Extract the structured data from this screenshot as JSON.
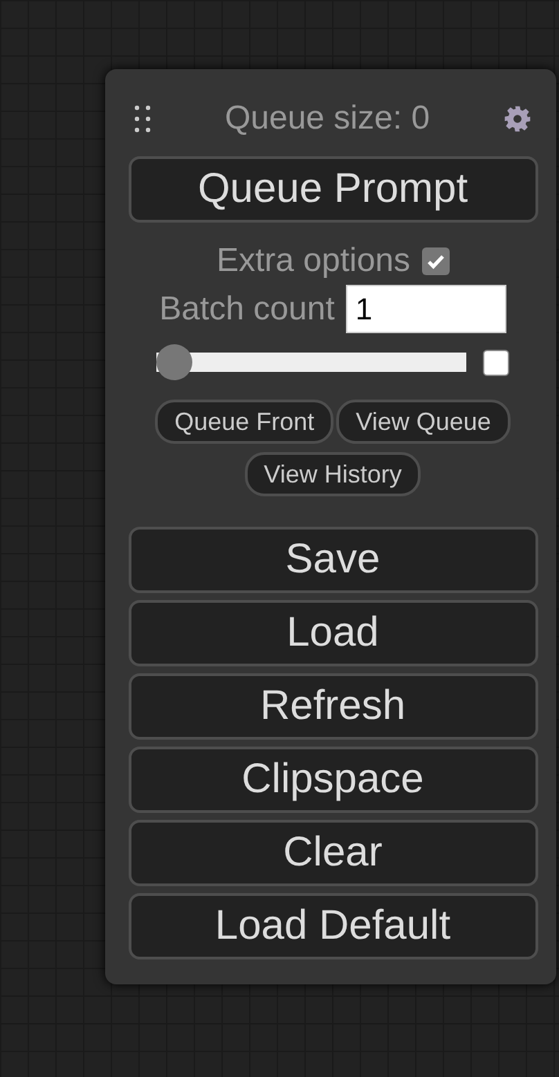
{
  "header": {
    "queue_size": "Queue size: 0"
  },
  "queue_button": "Queue Prompt",
  "extra_options": {
    "label": "Extra options",
    "checked": true
  },
  "batch": {
    "label": "Batch count",
    "value": "1",
    "level": 0,
    "toggle_checked": false
  },
  "small_buttons": [
    "Queue Front",
    "View Queue",
    "View History"
  ],
  "buttons": [
    "Save",
    "Load",
    "Refresh",
    "Clipspace",
    "Clear",
    "Load Default"
  ]
}
